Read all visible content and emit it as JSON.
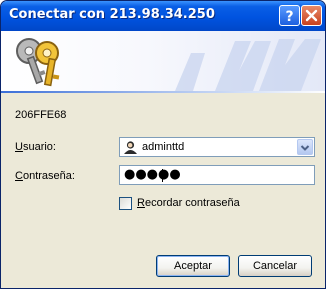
{
  "window": {
    "title": "Conectar con 213.98.34.250",
    "help_button": "?",
    "close_button": "✕"
  },
  "dialog": {
    "realm": "206FFE68",
    "username_label_prefix": "U",
    "username_label_rest": "suario:",
    "username_value": "adminttd",
    "password_label_prefix": "C",
    "password_label_rest": "ontraseña:",
    "password_value": "●●●●●",
    "remember_checked": false,
    "remember_label_prefix": "R",
    "remember_label_rest": "ecordar contraseña",
    "ok_label": "Aceptar",
    "cancel_label": "Cancelar"
  },
  "icons": {
    "banner": "keys-icon",
    "user": "user-icon",
    "dropdown": "chevron-down-icon"
  },
  "colors": {
    "titlebar": "#0053e0",
    "dialog_background": "#ece9d8",
    "input_border": "#7f9db9",
    "button_border": "#003c74"
  }
}
